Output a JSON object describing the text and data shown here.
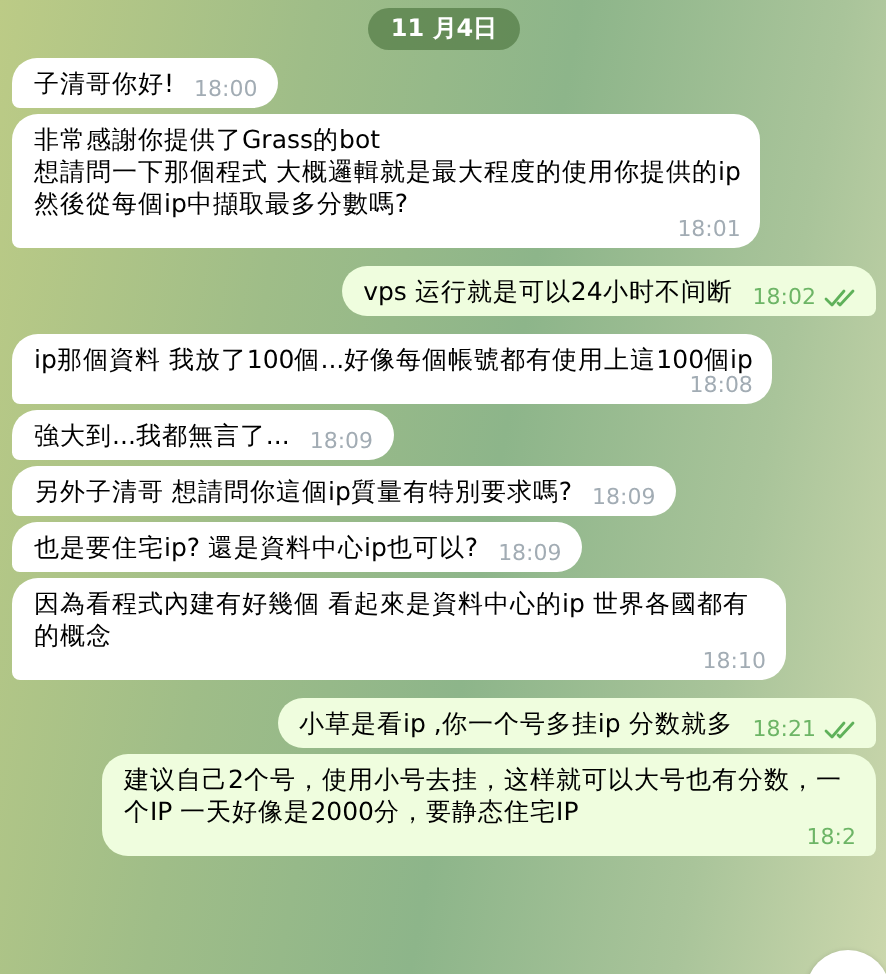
{
  "date_pill": "11 月4日",
  "messages": [
    {
      "kind": "incoming",
      "text": "子清哥你好!",
      "time": "18:00"
    },
    {
      "kind": "incoming",
      "text": "非常感謝你提供了Grass的bot\n想請問一下那個程式 大概邏輯就是最大程度的使用你提供的ip\n然後從每個ip中擷取最多分數嗎?",
      "time": "18:01"
    },
    {
      "kind": "outgoing",
      "text": "vps 运行就是可以24小时不间断",
      "time": "18:02",
      "read": true
    },
    {
      "kind": "incoming",
      "text": "ip那個資料 我放了100個...好像每個帳號都有使用上這100個ip",
      "time": "18:08"
    },
    {
      "kind": "incoming",
      "text": "強大到...我都無言了...",
      "time": "18:09"
    },
    {
      "kind": "incoming",
      "text": "另外子清哥 想請問你這個ip質量有特別要求嗎?",
      "time": "18:09"
    },
    {
      "kind": "incoming",
      "text": "也是要住宅ip? 還是資料中心ip也可以?",
      "time": "18:09"
    },
    {
      "kind": "incoming",
      "text": "因為看程式內建有好幾個 看起來是資料中心的ip 世界各國都有的概念",
      "time": "18:10"
    },
    {
      "kind": "outgoing",
      "text": "小草是看ip ,你一个号多挂ip 分数就多",
      "time": "18:21",
      "read": true
    },
    {
      "kind": "outgoing",
      "text": "建议自己2个号，使用小号去挂，这样就可以大号也有分数，一个IP 一天好像是2000分，要静态住宅IP",
      "time": "18:2",
      "read": false
    }
  ]
}
